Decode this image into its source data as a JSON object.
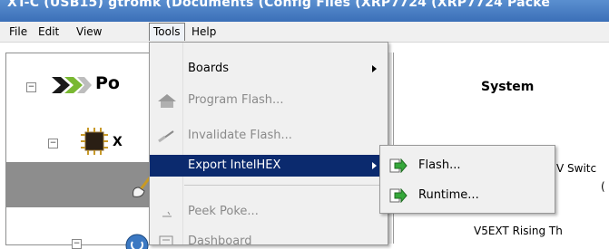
{
  "title": "XT-C (USB15) gtromk (Documents (Config Files (XRP7724 (XRP7724 Packe",
  "menubar": [
    "File",
    "Edit",
    "View",
    "Tools",
    "Help"
  ],
  "tree": {
    "root_label": "Po",
    "child_label": "X"
  },
  "tools_menu": {
    "items": [
      {
        "label": "Boards",
        "state": "enabled",
        "submenu": true
      },
      {
        "label": "Program Flash...",
        "state": "disabled"
      },
      {
        "label": "Invalidate Flash...",
        "state": "disabled"
      },
      {
        "label": "Export IntelHEX",
        "state": "highlighted",
        "submenu": true
      },
      {
        "label": "Peek Poke...",
        "state": "disabled"
      },
      {
        "label": "Dashboard",
        "state": "disabled"
      }
    ]
  },
  "export_submenu": [
    "Flash...",
    "Runtime..."
  ],
  "right_panel": {
    "heading": "System",
    "text1": "V Switc",
    "text2": "(",
    "text3": "V5EXT Rising Th"
  },
  "colors": {
    "titlebar": "#3b6fb8",
    "highlight": "#0b2a6e",
    "menu_bg": "#f0f0f0"
  }
}
